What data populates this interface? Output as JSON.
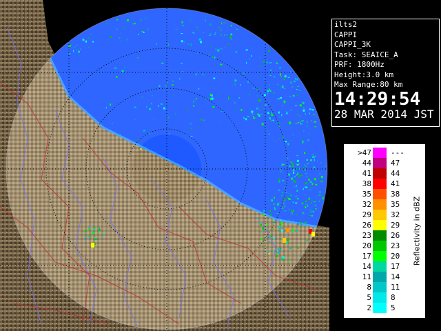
{
  "info": {
    "radar_id": "ilts2",
    "product": "CAPPI",
    "product_detail": "CAPPI_3K",
    "task": "Task: SEAICE_A",
    "prf": "PRF: 1800Hz",
    "height": "Height:3.0 km",
    "max_range": "Max Range:80 km",
    "time": "14:29:54",
    "date": "28 MAR 2014 JST"
  },
  "legend": {
    "axis_label": "Reflectivity in dBZ",
    "rows": [
      {
        "lo": ">47",
        "hi": "---",
        "color": "#ff00ff"
      },
      {
        "lo": "44",
        "hi": "47",
        "color": "#c0007e"
      },
      {
        "lo": "41",
        "hi": "44",
        "color": "#c00000"
      },
      {
        "lo": "38",
        "hi": "41",
        "color": "#ff0000"
      },
      {
        "lo": "35",
        "hi": "38",
        "color": "#ff5000"
      },
      {
        "lo": "32",
        "hi": "35",
        "color": "#ff9000"
      },
      {
        "lo": "29",
        "hi": "32",
        "color": "#ffc800"
      },
      {
        "lo": "26",
        "hi": "29",
        "color": "#ffff00"
      },
      {
        "lo": "23",
        "hi": "26",
        "color": "#008c00"
      },
      {
        "lo": "20",
        "hi": "23",
        "color": "#00c800"
      },
      {
        "lo": "17",
        "hi": "20",
        "color": "#00ff00"
      },
      {
        "lo": "14",
        "hi": "17",
        "color": "#00d8a0"
      },
      {
        "lo": "11",
        "hi": "14",
        "color": "#00a8a8"
      },
      {
        "lo": "8",
        "hi": "11",
        "color": "#00c8c8"
      },
      {
        "lo": "5",
        "hi": "8",
        "color": "#00e8e8"
      },
      {
        "lo": "2",
        "hi": "5",
        "color": "#00ffff"
      }
    ]
  },
  "colors": {
    "sea": "#1e5aff",
    "land_dark": "#5a4a32",
    "land_light": "#a89470",
    "panel_border": "#ffffff"
  }
}
